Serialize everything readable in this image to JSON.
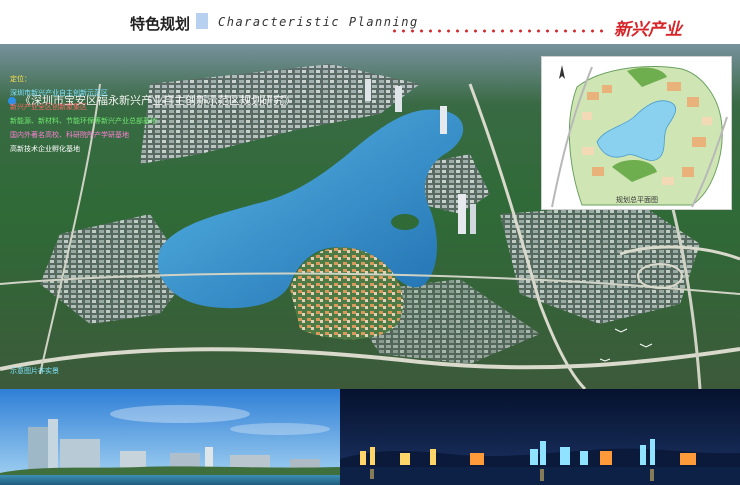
{
  "header": {
    "title_cn": "特色规划",
    "title_en": "Characteristic  Planning",
    "brand_text": "新兴产业"
  },
  "main": {
    "subtitle": "《深圳市宝安区福永新兴产业自主创新示范区规划研究》",
    "legend_title": "定位：",
    "positioning": [
      {
        "text": "深圳市新兴产业自主创新示范区",
        "color": "#7fe3ff"
      },
      {
        "text": "新兴产业全区创新聚集区",
        "color": "#ff6a6a"
      },
      {
        "text": "新能源、新材料、节能环保等新兴产业总部基地",
        "color": "#6fe86f"
      },
      {
        "text": "国内外著名高校、科研院所产学研基地",
        "color": "#ff7fd5"
      },
      {
        "text": "高新技术企业孵化基地",
        "color": "#ffffff"
      }
    ],
    "bottom_note": "示意图片非实景"
  },
  "inset": {
    "caption": "规划总平面图"
  },
  "colors": {
    "accent_red": "#d6262a",
    "lake": "#2f8fd0",
    "vegetation": "#2f6a37",
    "night_sky": "#06122e"
  }
}
